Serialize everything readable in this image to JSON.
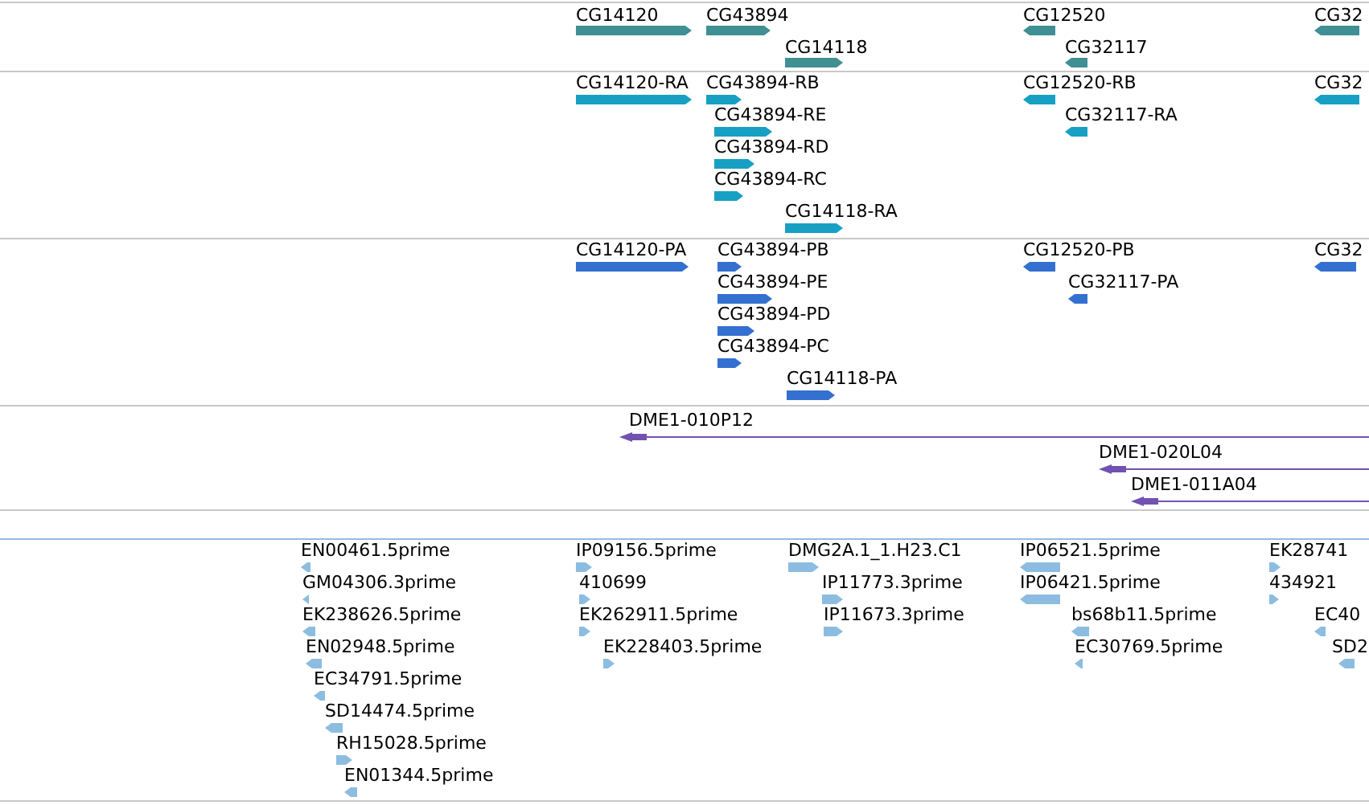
{
  "tracks": [
    {
      "kind": "genes",
      "color": "#3f8f93",
      "features": [
        {
          "label": "CG14120",
          "reverse": false
        },
        {
          "label": "CG43894",
          "reverse": false
        },
        {
          "label": "CG14118",
          "reverse": false
        },
        {
          "label": "CG12520",
          "reverse": true
        },
        {
          "label": "CG32117",
          "reverse": true
        },
        {
          "label": "CG32",
          "reverse": true
        }
      ]
    },
    {
      "kind": "genes",
      "color": "#17a0c4",
      "features": [
        {
          "label": "CG14120-RA",
          "reverse": false
        },
        {
          "label": "CG43894-RB",
          "reverse": false
        },
        {
          "label": "CG43894-RE",
          "reverse": false
        },
        {
          "label": "CG43894-RD",
          "reverse": false
        },
        {
          "label": "CG43894-RC",
          "reverse": false
        },
        {
          "label": "CG14118-RA",
          "reverse": false
        },
        {
          "label": "CG12520-RB",
          "reverse": true
        },
        {
          "label": "CG32117-RA",
          "reverse": true
        },
        {
          "label": "CG32",
          "reverse": true
        }
      ]
    },
    {
      "kind": "genes",
      "color": "#3370d0",
      "features": [
        {
          "label": "CG14120-PA",
          "reverse": false
        },
        {
          "label": "CG43894-PB",
          "reverse": false
        },
        {
          "label": "CG43894-PE",
          "reverse": false
        },
        {
          "label": "CG43894-PD",
          "reverse": false
        },
        {
          "label": "CG43894-PC",
          "reverse": false
        },
        {
          "label": "CG14118-PA",
          "reverse": false
        },
        {
          "label": "CG12520-PB",
          "reverse": true
        },
        {
          "label": "CG32117-PA",
          "reverse": true
        },
        {
          "label": "CG32",
          "reverse": true
        }
      ]
    },
    {
      "kind": "clones",
      "color": "#7252b0",
      "features": [
        {
          "label": "DME1-010P12",
          "reverse": true
        },
        {
          "label": "DME1-020L04",
          "reverse": true
        },
        {
          "label": "DME1-011A04",
          "reverse": true
        }
      ]
    },
    {
      "kind": "empty"
    },
    {
      "kind": "genes",
      "color": "#8cbde0",
      "features": [
        {
          "label": "EN00461.5prime",
          "reverse": true
        },
        {
          "label": "GM04306.3prime",
          "reverse": true
        },
        {
          "label": "EK238626.5prime",
          "reverse": true
        },
        {
          "label": "EN02948.5prime",
          "reverse": true
        },
        {
          "label": "EC34791.5prime",
          "reverse": true
        },
        {
          "label": "SD14474.5prime",
          "reverse": true
        },
        {
          "label": "RH15028.5prime",
          "reverse": false
        },
        {
          "label": "EN01344.5prime",
          "reverse": true
        },
        {
          "label": "IP09156.5prime",
          "reverse": false
        },
        {
          "label": "410699",
          "reverse": false
        },
        {
          "label": "EK262911.5prime",
          "reverse": false
        },
        {
          "label": "EK228403.5prime",
          "reverse": false
        },
        {
          "label": "DMG2A.1_1.H23.C1",
          "reverse": false
        },
        {
          "label": "IP11773.3prime",
          "reverse": false
        },
        {
          "label": "IP11673.3prime",
          "reverse": false
        },
        {
          "label": "IP06521.5prime",
          "reverse": true
        },
        {
          "label": "IP06421.5prime",
          "reverse": true
        },
        {
          "label": "bs68b11.5prime",
          "reverse": true
        },
        {
          "label": "EC30769.5prime",
          "reverse": true
        },
        {
          "label": "EK28741",
          "reverse": false
        },
        {
          "label": "434921",
          "reverse": false
        },
        {
          "label": "EC40",
          "reverse": true
        },
        {
          "label": "SD2",
          "reverse": true
        }
      ]
    }
  ]
}
